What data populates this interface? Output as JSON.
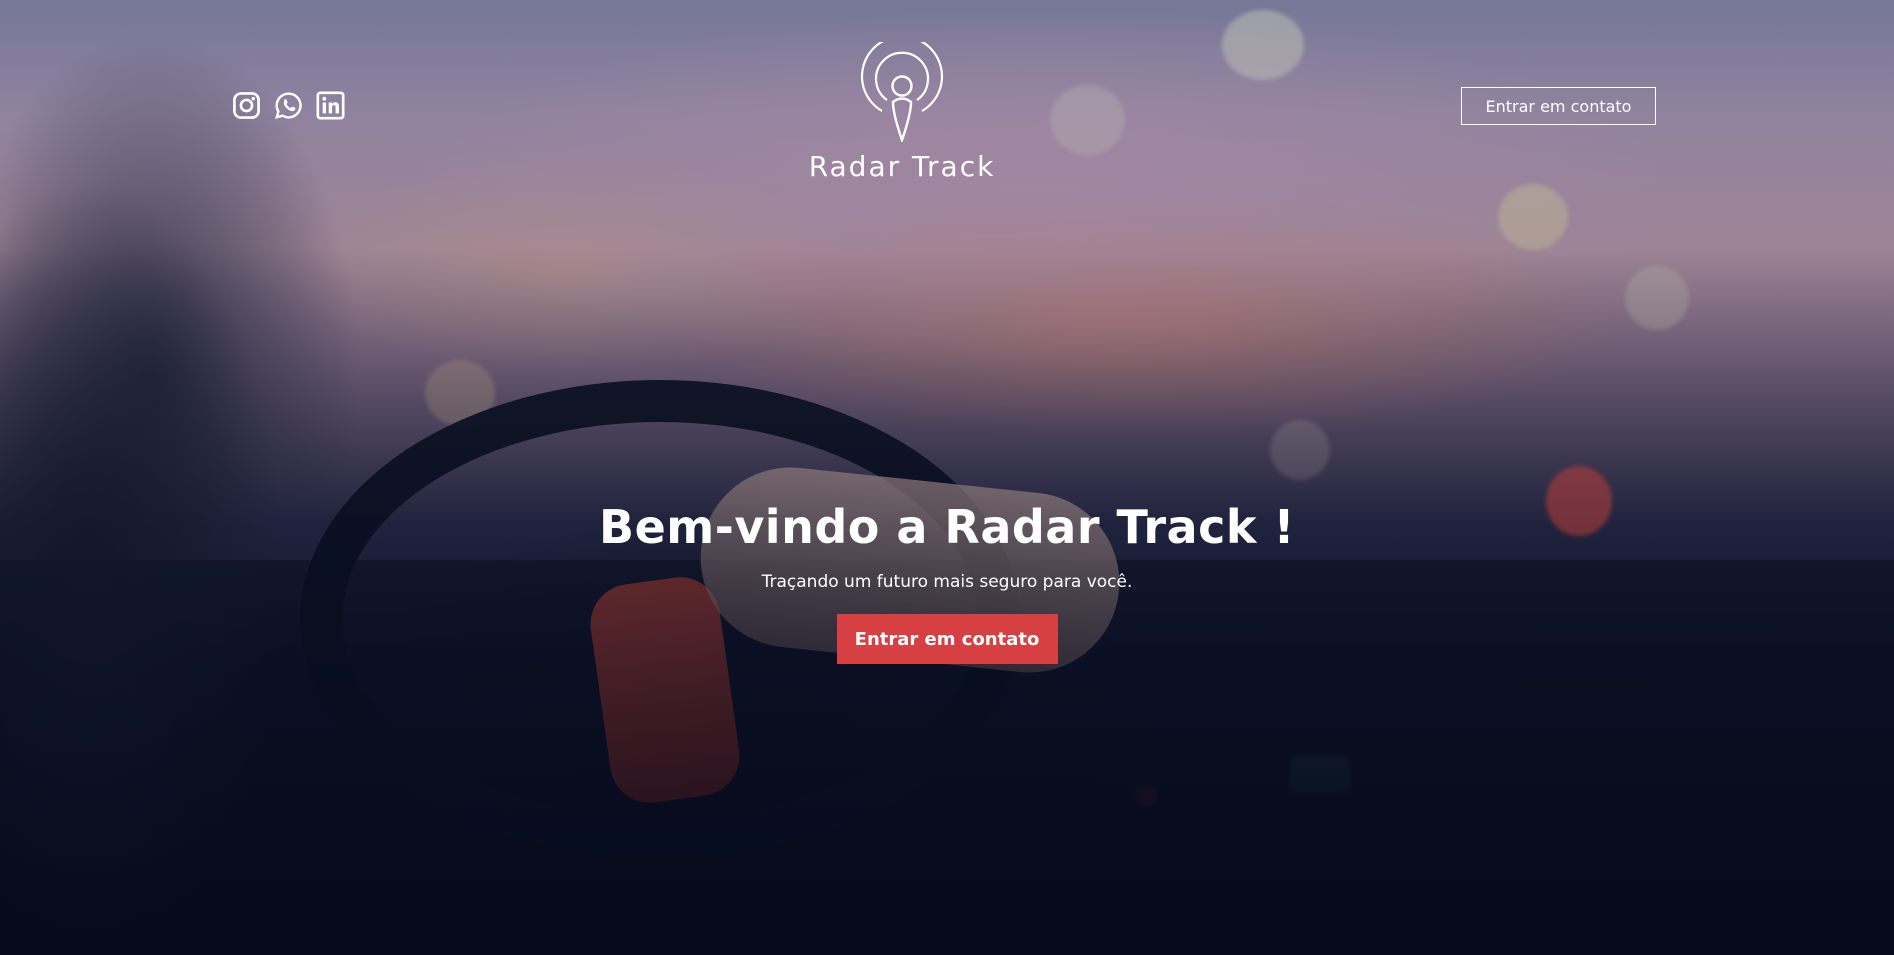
{
  "header": {
    "social_icons": [
      "instagram-icon",
      "whatsapp-icon",
      "linkedin-icon"
    ],
    "logo_text": "Radar Track",
    "cta_label": "Entrar em contato"
  },
  "hero": {
    "headline": "Bem-vindo a Radar Track !",
    "subheadline": "Traçando um futuro mais seguro para você.",
    "cta_label": "Entrar em contato"
  },
  "colors": {
    "accent": "#d64043",
    "text": "#ffffff",
    "background": "#0b1226"
  }
}
